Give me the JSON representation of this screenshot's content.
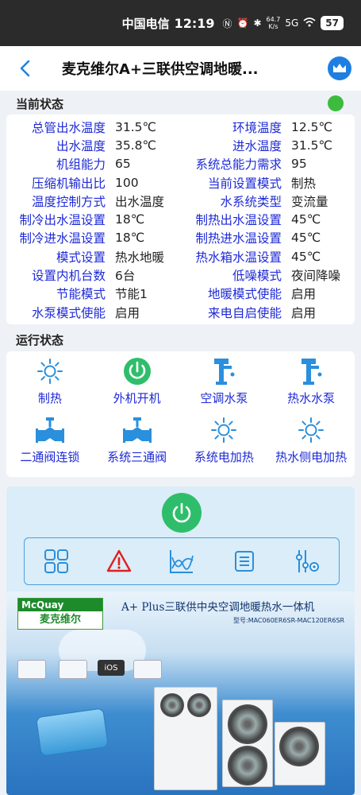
{
  "status_bar": {
    "carrier": "中国电信",
    "time": "12:19",
    "net_speed_value": "64.7",
    "net_speed_unit": "K/s",
    "signal": "5G",
    "battery": "57"
  },
  "header": {
    "title": "麦克维尔A+三联供空调地暖..."
  },
  "current_status": {
    "title": "当前状态",
    "rows": [
      {
        "l1": "总管出水温度",
        "v1": "31.5℃",
        "l2": "环境温度",
        "v2": "12.5℃"
      },
      {
        "l1": "出水温度",
        "v1": "35.8℃",
        "l2": "进水温度",
        "v2": "31.5℃"
      },
      {
        "l1": "机组能力",
        "v1": "65",
        "l2": "系统总能力需求",
        "v2": "95"
      },
      {
        "l1": "压缩机输出比",
        "v1": "100",
        "l2": "当前设置模式",
        "v2": "制热"
      },
      {
        "l1": "温度控制方式",
        "v1": "出水温度",
        "l2": "水系统类型",
        "v2": "变流量"
      },
      {
        "l1": "制冷出水温设置",
        "v1": "18℃",
        "l2": "制热出水温设置",
        "v2": "45℃"
      },
      {
        "l1": "制冷进水温设置",
        "v1": "18℃",
        "l2": "制热进水温设置",
        "v2": "45℃"
      },
      {
        "l1": "模式设置",
        "v1": "热水地暖",
        "l2": "热水箱水温设置",
        "v2": "45℃"
      },
      {
        "l1": "设置内机台数",
        "v1": "6台",
        "l2": "低噪模式",
        "v2": "夜间降噪"
      },
      {
        "l1": "节能模式",
        "v1": "节能1",
        "l2": "地暖模式使能",
        "v2": "启用"
      },
      {
        "l1": "水泵模式使能",
        "v1": "启用",
        "l2": "来电自启使能",
        "v2": "启用"
      }
    ]
  },
  "running_state": {
    "title": "运行状态",
    "items": [
      {
        "label": "制热",
        "icon": "sun-icon"
      },
      {
        "label": "外机开机",
        "icon": "power-on-icon"
      },
      {
        "label": "空调水泵",
        "icon": "water-pump-icon"
      },
      {
        "label": "热水水泵",
        "icon": "water-pump-icon"
      },
      {
        "label": "二通阀连锁",
        "icon": "valve-icon"
      },
      {
        "label": "系统三通阀",
        "icon": "valve-icon"
      },
      {
        "label": "系统电加热",
        "icon": "sun-icon"
      },
      {
        "label": "热水侧电加热",
        "icon": "sun-icon"
      }
    ]
  },
  "toolbar": {
    "items": [
      "grid-menu-icon",
      "alarm-warning-icon",
      "trend-chart-icon",
      "list-icon",
      "settings-sliders-icon"
    ]
  },
  "banner": {
    "brand": "McQuay",
    "brand_cn": "麦克维尔",
    "title": "A+ Plus三联供中央空调地暖热水一体机",
    "model": "型号:MAC060ER6SR-MAC120ER6SR",
    "ios_label": "iOS"
  },
  "colors": {
    "accent": "#1e7fe0",
    "label_blue": "#1e2ad6",
    "status_green": "#3dbb3d",
    "power_green": "#2ebe6b",
    "alarm_red": "#e02020"
  }
}
